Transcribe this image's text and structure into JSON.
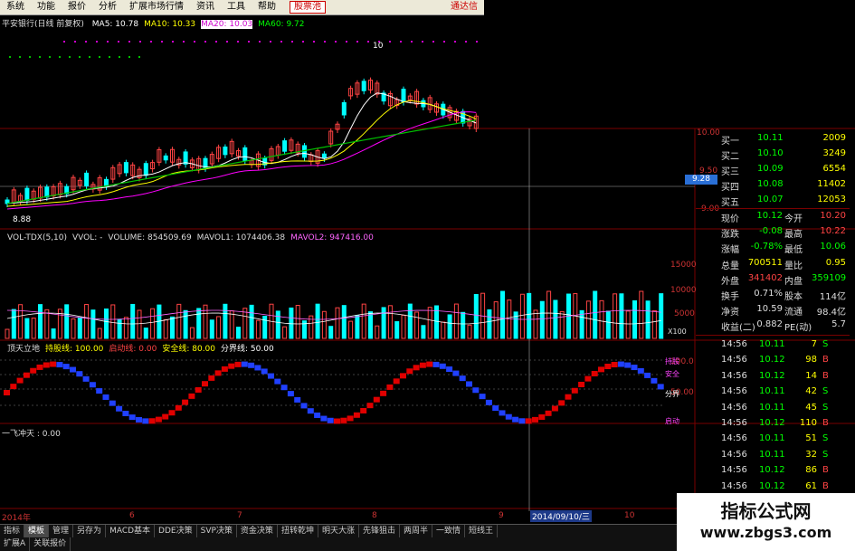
{
  "menu": {
    "items": [
      "系统",
      "功能",
      "报价",
      "分析",
      "扩展市场行情",
      "资讯",
      "工具",
      "帮助"
    ],
    "highlight": "股票池",
    "right": "通达信"
  },
  "price_panel": {
    "title": "平安银行(日线 前复权)",
    "ma_labels": [
      {
        "text": "MA5: 10.78",
        "color": "#ffffff"
      },
      {
        "text": "MA10: 10.33",
        "color": "#ffff00"
      },
      {
        "text": "MA20: 10.03",
        "color": "#ff00ff"
      },
      {
        "text": "MA60: 9.72",
        "color": "#00ff00"
      }
    ],
    "low_marker": "8.88",
    "high_marker": "10",
    "axis": [
      "10.00",
      "9.50",
      "9.00"
    ],
    "price_tag": "9.28"
  },
  "volume_panel": {
    "labels": [
      {
        "text": "VOL-TDX(5,10)",
        "color": "#dddddd"
      },
      {
        "text": "VVOL: -",
        "color": "#dddddd"
      },
      {
        "text": "VOLUME: 854509.69",
        "color": "#dddddd"
      },
      {
        "text": "MAVOL1: 1074406.38",
        "color": "#dddddd"
      },
      {
        "text": "MAVOL2: 947416.00",
        "color": "#ff66ff"
      }
    ],
    "axis": [
      "15000",
      "10000",
      "5000",
      "X100"
    ]
  },
  "indicator_panel": {
    "labels": [
      {
        "text": "顶天立地",
        "color": "#dddddd"
      },
      {
        "text": "持股线: 100.00",
        "color": "#ffff00"
      },
      {
        "text": "启动线: 0.00",
        "color": "#ff4444"
      },
      {
        "text": "安全线: 80.00",
        "color": "#ffff00"
      },
      {
        "text": "分界线: 50.00",
        "color": "#ffffff"
      }
    ],
    "axis": [
      "100.0",
      "50.00"
    ],
    "right_labels": [
      "持股",
      "安全",
      "分界",
      "启动"
    ]
  },
  "fourth_panel": {
    "label": "一飞冲天 : 0.00"
  },
  "time_axis": {
    "labels": [
      "2014年",
      "6",
      "7",
      "8",
      "9",
      "10"
    ],
    "cursor_date": "2014/09/10/三"
  },
  "order_book": [
    {
      "label": "买一",
      "price": "10.11",
      "vol": "2009"
    },
    {
      "label": "买二",
      "price": "10.10",
      "vol": "3249"
    },
    {
      "label": "买三",
      "price": "10.09",
      "vol": "6554"
    },
    {
      "label": "买四",
      "price": "10.08",
      "vol": "11402"
    },
    {
      "label": "买五",
      "price": "10.07",
      "vol": "12053"
    }
  ],
  "stats": [
    {
      "l1": "现价",
      "v1": "10.12",
      "l2": "今开",
      "v2": "10.20",
      "c1": "#00ff00",
      "c2": "#ff4444"
    },
    {
      "l1": "涨跌",
      "v1": "-0.08",
      "l2": "最高",
      "v2": "10.22",
      "c1": "#00ff00",
      "c2": "#ff4444"
    },
    {
      "l1": "涨幅",
      "v1": "-0.78%",
      "l2": "最低",
      "v2": "10.06",
      "c1": "#00ff00",
      "c2": "#00ff00"
    },
    {
      "l1": "总量",
      "v1": "700511",
      "l2": "量比",
      "v2": "0.95",
      "c1": "#ffff00",
      "c2": "#ffff00"
    },
    {
      "l1": "外盘",
      "v1": "341402",
      "l2": "内盘",
      "v2": "359109",
      "c1": "#ff4444",
      "c2": "#00ff00"
    },
    {
      "l1": "换手",
      "v1": "0.71%",
      "l2": "股本",
      "v2": "114亿",
      "c1": "#dddddd",
      "c2": "#dddddd"
    },
    {
      "l1": "净资",
      "v1": "10.59",
      "l2": "流通",
      "v2": "98.4亿",
      "c1": "#dddddd",
      "c2": "#dddddd"
    },
    {
      "l1": "收益(二)",
      "v1": "0.882",
      "l2": "PE(动)",
      "v2": "5.7",
      "c1": "#dddddd",
      "c2": "#dddddd"
    }
  ],
  "ticks": [
    {
      "time": "14:56",
      "price": "10.11",
      "vol": "7",
      "side": "S",
      "pc": "#00ff00",
      "sc": "#00ff00"
    },
    {
      "time": "14:56",
      "price": "10.12",
      "vol": "98",
      "side": "B",
      "pc": "#00ff00",
      "sc": "#ff4444"
    },
    {
      "time": "14:56",
      "price": "10.12",
      "vol": "14",
      "side": "B",
      "pc": "#00ff00",
      "sc": "#ff4444"
    },
    {
      "time": "14:56",
      "price": "10.11",
      "vol": "42",
      "side": "S",
      "pc": "#00ff00",
      "sc": "#00ff00"
    },
    {
      "time": "14:56",
      "price": "10.11",
      "vol": "45",
      "side": "S",
      "pc": "#00ff00",
      "sc": "#00ff00"
    },
    {
      "time": "14:56",
      "price": "10.12",
      "vol": "110",
      "side": "B",
      "pc": "#00ff00",
      "sc": "#ff4444"
    },
    {
      "time": "14:56",
      "price": "10.11",
      "vol": "51",
      "side": "S",
      "pc": "#00ff00",
      "sc": "#00ff00"
    },
    {
      "time": "14:56",
      "price": "10.11",
      "vol": "32",
      "side": "S",
      "pc": "#00ff00",
      "sc": "#00ff00"
    },
    {
      "time": "14:56",
      "price": "10.12",
      "vol": "86",
      "side": "B",
      "pc": "#00ff00",
      "sc": "#ff4444"
    },
    {
      "time": "14:56",
      "price": "10.12",
      "vol": "61",
      "side": "B",
      "pc": "#00ff00",
      "sc": "#ff4444"
    }
  ],
  "tabs_row1": [
    "指标",
    "模板",
    "管理",
    "另存为",
    "MACD基本",
    "DDE决策",
    "SVP决策",
    "资金决策",
    "扭转乾坤",
    "明天大涨",
    "先锋狙击",
    "两周半",
    "一致情",
    "短线王"
  ],
  "tabs_row2": [
    "扩展A",
    "关联报价"
  ],
  "watermark": {
    "title": "指标公式网",
    "url": "www.zbgs3.com"
  }
}
